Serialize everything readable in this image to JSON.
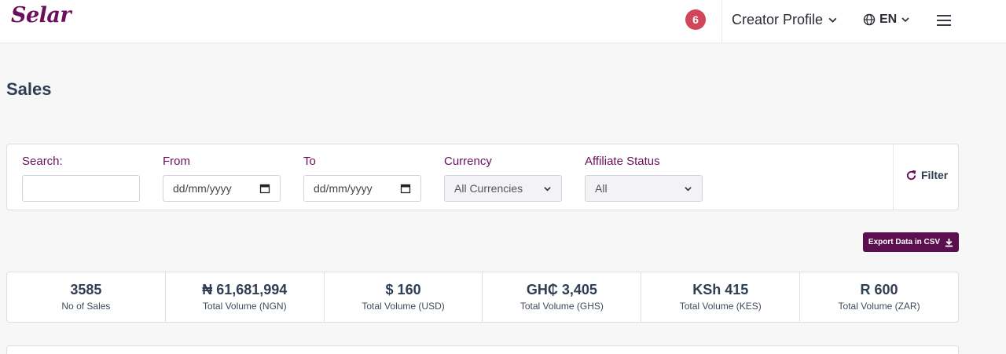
{
  "header": {
    "logo_text": "Selar",
    "notification_count": "6",
    "profile_label": "Creator Profile",
    "language": "EN"
  },
  "page": {
    "title": "Sales"
  },
  "filters": {
    "search_label": "Search:",
    "search_value": "",
    "from_label": "From",
    "from_placeholder": "dd/mm/yyyy",
    "to_label": "To",
    "to_placeholder": "dd/mm/yyyy",
    "currency_label": "Currency",
    "currency_selected": "All Currencies",
    "affiliate_label": "Affiliate Status",
    "affiliate_selected": "All",
    "filter_button": "Filter"
  },
  "export_button": "Export Data in CSV",
  "stats": [
    {
      "value": "3585",
      "label": "No of Sales"
    },
    {
      "value": "₦ 61,681,994",
      "label": "Total Volume (NGN)"
    },
    {
      "value": "$ 160",
      "label": "Total Volume (USD)"
    },
    {
      "value": "GH₵ 3,405",
      "label": "Total Volume (GHS)"
    },
    {
      "value": "KSh 415",
      "label": "Total Volume (KES)"
    },
    {
      "value": "R 600",
      "label": "Total Volume (ZAR)"
    }
  ],
  "colors": {
    "brand": "#6b0f5c",
    "export_button": "#5c0f4f",
    "badge": "#d0465b"
  },
  "icons": [
    "globe-icon",
    "chevron-down-icon",
    "hamburger-menu-icon",
    "calendar-icon",
    "refresh-icon",
    "download-icon"
  ]
}
